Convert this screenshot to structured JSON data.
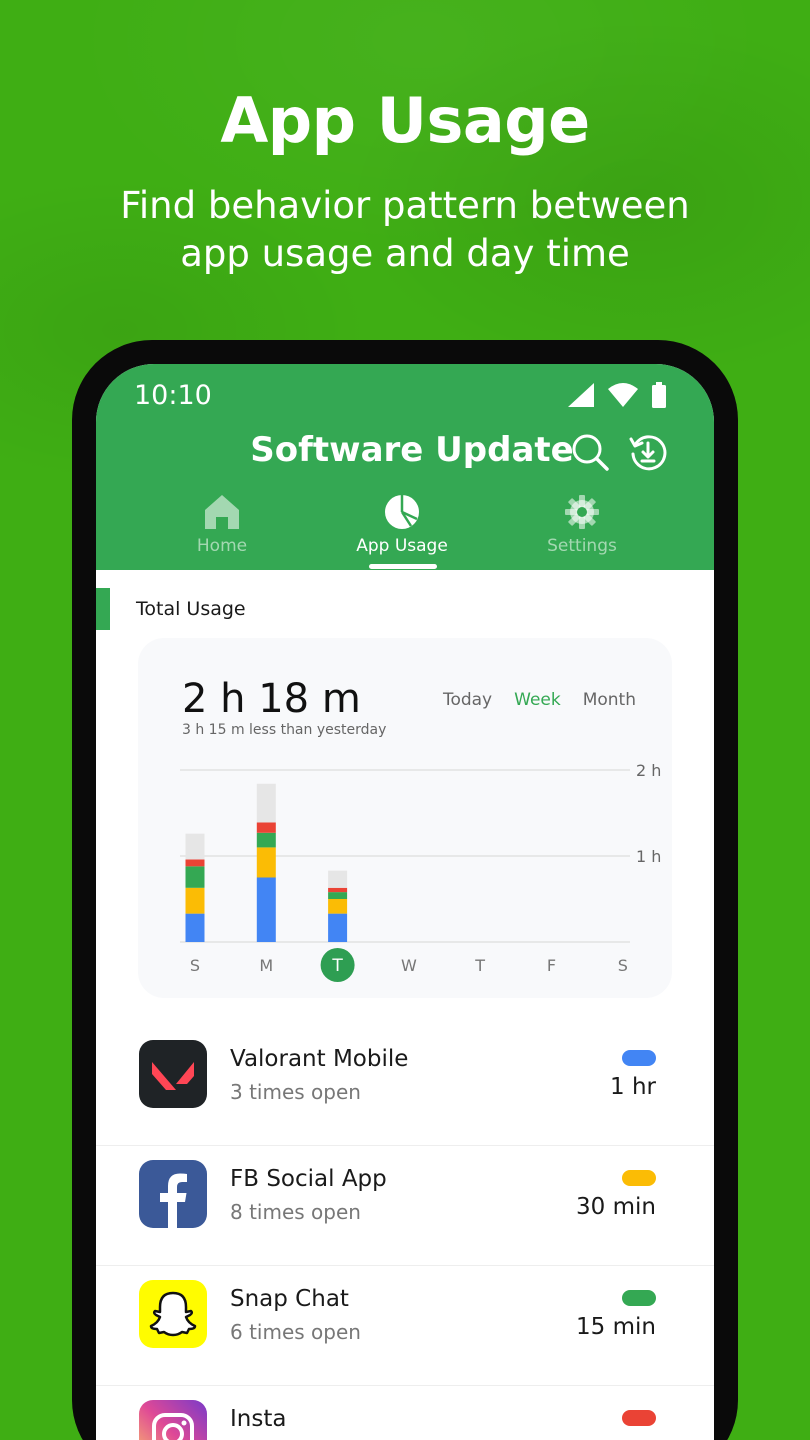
{
  "promo": {
    "title": "App Usage",
    "subtitle_line1": "Find behavior pattern between",
    "subtitle_line2": "app usage and day time"
  },
  "status_bar": {
    "time": "10:10",
    "icons": [
      "signal-icon",
      "wifi-icon",
      "battery-icon"
    ]
  },
  "app_bar": {
    "title": "Software Update",
    "actions": [
      "search-icon",
      "update-history-icon"
    ]
  },
  "tabs": [
    {
      "label": "Home",
      "icon": "home-icon",
      "active": false
    },
    {
      "label": "App Usage",
      "icon": "pie-chart-icon",
      "active": true
    },
    {
      "label": "Settings",
      "icon": "gear-icon",
      "active": false
    }
  ],
  "usage": {
    "section_title": "Total Usage",
    "total": "2 h 18 m",
    "delta": "3 h 15 m less than yesterday",
    "ranges": [
      "Today",
      "Week",
      "Month"
    ],
    "active_range": "Week"
  },
  "colors": {
    "brand": "#34a853",
    "background": "#3fae14",
    "blue": "#4285f4",
    "yellow": "#fbbc05",
    "green": "#34a853",
    "red": "#ea4335",
    "other": "#e6e6e6"
  },
  "chart_data": {
    "type": "bar",
    "stacked": true,
    "categories": [
      "S",
      "M",
      "T",
      "W",
      "T",
      "F",
      "S"
    ],
    "selected_index": 2,
    "y_ticks": [
      "1 h",
      "2 h"
    ],
    "ylim": [
      0,
      2
    ],
    "series": [
      {
        "color": "#4285f4",
        "values": [
          0.33,
          0.75,
          0.33,
          0,
          0,
          0,
          0
        ]
      },
      {
        "color": "#fbbc05",
        "values": [
          0.3,
          0.35,
          0.17,
          0,
          0,
          0,
          0
        ]
      },
      {
        "color": "#34a853",
        "values": [
          0.25,
          0.17,
          0.08,
          0,
          0,
          0,
          0
        ]
      },
      {
        "color": "#ea4335",
        "values": [
          0.08,
          0.12,
          0.05,
          0,
          0,
          0,
          0
        ]
      },
      {
        "color": "#e6e6e6",
        "values": [
          0.3,
          0.45,
          0.2,
          0,
          0,
          0,
          0
        ]
      }
    ]
  },
  "apps": [
    {
      "name": "Valorant Mobile",
      "opens": "3 times open",
      "duration": "1 hr",
      "color": "#4285f4",
      "icon": "valorant-logo-icon"
    },
    {
      "name": "FB Social App",
      "opens": "8 times open",
      "duration": "30 min",
      "color": "#fbbc05",
      "icon": "facebook-logo-icon"
    },
    {
      "name": "Snap Chat",
      "opens": "6 times open",
      "duration": "15 min",
      "color": "#34a853",
      "icon": "snapchat-logo-icon"
    },
    {
      "name": "Insta",
      "opens": "",
      "duration": "",
      "color": "#ea4335",
      "icon": "instagram-logo-icon"
    }
  ]
}
